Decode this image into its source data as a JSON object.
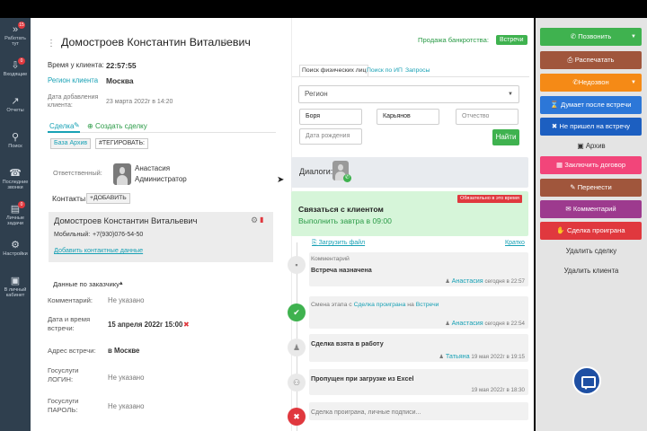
{
  "nav": [
    {
      "icon": "»",
      "label": "Работать тут",
      "badge": "15"
    },
    {
      "icon": "⇩",
      "label": "Входящие",
      "badge": "0"
    },
    {
      "icon": "↗",
      "label": "Отчеты",
      "badge": ""
    },
    {
      "icon": "⚲",
      "label": "Поиск",
      "badge": ""
    },
    {
      "icon": "☎",
      "label": "Последние звонки",
      "badge": ""
    },
    {
      "icon": "▤",
      "label": "Личные задачи",
      "badge": "0"
    },
    {
      "icon": "⚙",
      "label": "Настройки",
      "badge": ""
    },
    {
      "icon": "▣",
      "label": "В личный кабинет",
      "badge": ""
    }
  ],
  "header": {
    "title": "Домостроев Константин Витальевич",
    "bankrupt": "Продажа банкротства:",
    "meeting_badge": "Встречи"
  },
  "client": {
    "time_label": "Время у клиента:",
    "time": "22:57:55",
    "region_label": "Регион клиента",
    "region": "Москва",
    "added_label": "Дата добавления клиента:",
    "added": "23 марта 2022г в 14:20"
  },
  "deal": {
    "tab": "Сделка",
    "create": "Создать сделку",
    "base": "База Архив",
    "tag": "#ТЕГИРОВАТЬ:"
  },
  "responsible": {
    "label": "Ответственный:",
    "name": "Анастасия",
    "role": "Администратор"
  },
  "contacts": {
    "title": "Контакты",
    "add": "+ДОБАВИТЬ",
    "name": "Домостроев Константин Витальевич",
    "mobile_label": "Мобильный:",
    "mobile": "+7(930)076-54-50",
    "add_data": "Добавить контактные данные"
  },
  "customer": {
    "section": "Данные по заказчику",
    "rows": [
      {
        "label": "Комментарий:",
        "value": "Не указано"
      },
      {
        "label": "Дата и время встречи:",
        "value": "15 апреля 2022г 15:00"
      },
      {
        "label": "Адрес встречи:",
        "value": "в Москве"
      },
      {
        "label": "Госуслуги ЛОГИН:",
        "value": "Не указано"
      },
      {
        "label": "Госуслуги ПАРОЛЬ:",
        "value": "Не указано"
      }
    ]
  },
  "search": {
    "tabs": [
      "Поиск физических лиц",
      "Поиск по ИП",
      "Запросы"
    ],
    "region": "Регион",
    "last": "Боря",
    "first": "Карьянов",
    "middle": "Отчество",
    "birth": "Дата рождения",
    "find": "Найти"
  },
  "dialogs": {
    "label": "Диалоги:"
  },
  "task": {
    "title": "Связаться с клиентом",
    "sub": "Выполнить завтра в 09:00",
    "badge": "Обязательно в это время"
  },
  "files": {
    "upload": "Загрузить файл",
    "short": "Кратко"
  },
  "timeline": [
    {
      "kind": "Комментарий",
      "text": "Встреча назначена",
      "author": "Анастасия",
      "when": "сегодня в 22:57"
    },
    {
      "prefix": "Смена этапа с",
      "from": "Сделка проиграна",
      "mid": "на",
      "to": "Встречи",
      "author": "Анастасия",
      "when": "сегодня в 22:54"
    },
    {
      "text": "Сделка взята в работу",
      "author": "Татьяна",
      "when": "19 мая 2022г в 19:15"
    },
    {
      "text": "Пропущен при загрузке из Excel",
      "when": "19 мая 2022г в 18:30"
    },
    {
      "text": "Сделка проиграна, личные подписи..."
    }
  ],
  "actions": {
    "call": "Позвонить",
    "print": "Распечатать",
    "nocall": "Недозвон",
    "think": "Думает после встречи",
    "noshow": "Не пришел на встречу",
    "archive": "Архив",
    "contract": "Заключить договор",
    "move": "Перенести",
    "comments": "Комментарий",
    "lost": "Сделка проиграна",
    "delete_deal": "Удалить сделку",
    "delete_client": "Удалить клиента"
  },
  "colors": {
    "green": "#3fb24f",
    "brown": "#a0563c",
    "orange": "#f58a16",
    "blue": "#2c77d8",
    "blue2": "#1c5fc1",
    "pink": "#f2457a",
    "purple": "#9d3a8e",
    "red": "#e0383e"
  }
}
